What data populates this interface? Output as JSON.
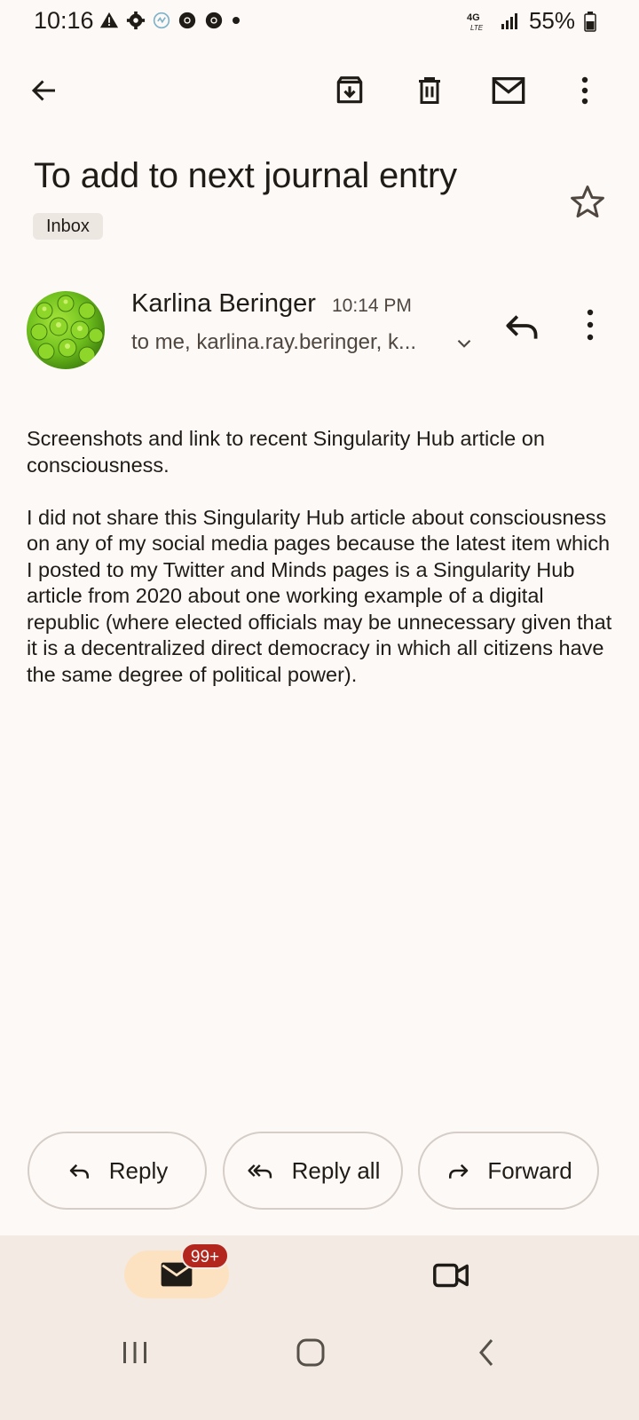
{
  "status_bar": {
    "time": "10:16",
    "network": "4G LTE",
    "battery": "55%"
  },
  "toolbar": {
    "back_icon": "arrow-left-icon",
    "archive_icon": "archive-icon",
    "delete_icon": "trash-icon",
    "mark_unread_icon": "envelope-icon",
    "more_icon": "more-vertical-icon"
  },
  "email": {
    "subject": "To add to next journal entry",
    "label": "Inbox",
    "sender_name": "Karlina Beringer",
    "time": "10:14 PM",
    "recipients": "to me, karlina.ray.beringer, k...",
    "body": [
      "Screenshots and link to recent Singularity Hub article on consciousness.",
      "I did not share this Singularity Hub article about consciousness on any of my social media pages because the latest item which I posted to my Twitter and Minds pages is a Singularity Hub article from 2020 about one working example of a digital republic (where elected officials may be unnecessary given that it is a decentralized direct democracy in which all citizens have the same degree of political power)."
    ]
  },
  "actions": {
    "reply": "Reply",
    "reply_all": "Reply all",
    "forward": "Forward"
  },
  "bottom_nav": {
    "mail_badge": "99+",
    "accent": "#fde2c2",
    "badge_color": "#b3261e"
  }
}
